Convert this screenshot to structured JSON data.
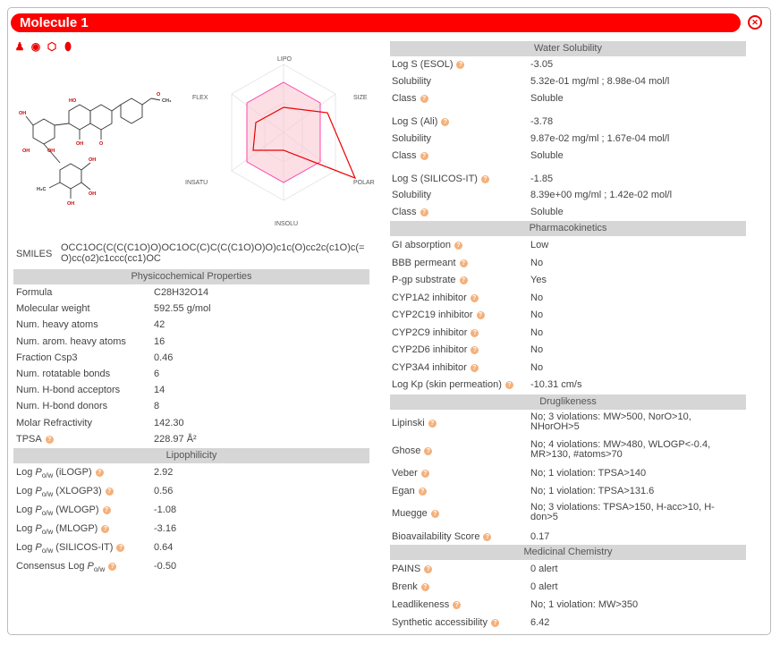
{
  "title": "Molecule 1",
  "close_icon": "close-circle-icon",
  "toolbar_icons": [
    "people-icon",
    "target-icon",
    "hexagon-icon",
    "pill-icon"
  ],
  "molecule_labels": {
    "methoxy": "O",
    "ch3": "CH₃",
    "oh": "OH",
    "h3c": "H₃C",
    "ho": "HO",
    "o": "O"
  },
  "radar": {
    "lipo": "LIPO",
    "size": "SIZE",
    "polar": "POLAR",
    "insolu": "INSOLU",
    "insatu": "INSATU",
    "flex": "FLEX"
  },
  "smiles": {
    "label": "SMILES",
    "value": "OCC1OC(C(C(C1O)O)OC1OC(C)C(C(C1O)O)O)c1c(O)cc2c(c1O)c(=O)cc(o2)c1ccc(cc1)OC"
  },
  "physchem": {
    "header": "Physicochemical Properties",
    "rows": [
      {
        "label": "Formula",
        "value": "C28H32O14"
      },
      {
        "label": "Molecular weight",
        "value": "592.55 g/mol"
      },
      {
        "label": "Num. heavy atoms",
        "value": "42"
      },
      {
        "label": "Num. arom. heavy atoms",
        "value": "16"
      },
      {
        "label": "Fraction Csp3",
        "value": "0.46"
      },
      {
        "label": "Num. rotatable bonds",
        "value": "6"
      },
      {
        "label": "Num. H-bond acceptors",
        "value": "14"
      },
      {
        "label": "Num. H-bond donors",
        "value": "8"
      },
      {
        "label": "Molar Refractivity",
        "value": "142.30"
      },
      {
        "label": "TPSA",
        "value": "228.97 Å²"
      }
    ]
  },
  "lipophilicity": {
    "header": "Lipophilicity",
    "rows": [
      {
        "prefix": "Log ",
        "p": "P",
        "sub": "o/w",
        "suffix": " (iLOGP)",
        "value": "2.92"
      },
      {
        "prefix": "Log ",
        "p": "P",
        "sub": "o/w",
        "suffix": " (XLOGP3)",
        "value": "0.56"
      },
      {
        "prefix": "Log ",
        "p": "P",
        "sub": "o/w",
        "suffix": " (WLOGP)",
        "value": "-1.08"
      },
      {
        "prefix": "Log ",
        "p": "P",
        "sub": "o/w",
        "suffix": " (MLOGP)",
        "value": "-3.16"
      },
      {
        "prefix": "Log ",
        "p": "P",
        "sub": "o/w",
        "suffix": " (SILICOS-IT)",
        "value": "0.64"
      },
      {
        "prefix": "Consensus Log ",
        "p": "P",
        "sub": "o/w",
        "suffix": "",
        "value": "-0.50"
      }
    ]
  },
  "solubility": {
    "header": "Water Solubility",
    "rows": [
      {
        "label": "Log S (ESOL)",
        "value": "-3.05"
      },
      {
        "label": "Solubility",
        "value": "5.32e-01 mg/ml ; 8.98e-04 mol/l"
      },
      {
        "label": "Class",
        "value": "Soluble"
      },
      {
        "label": "Log S (Ali)",
        "value": "-3.78"
      },
      {
        "label": "Solubility",
        "value": "9.87e-02 mg/ml ; 1.67e-04 mol/l"
      },
      {
        "label": "Class",
        "value": "Soluble"
      },
      {
        "label": "Log S (SILICOS-IT)",
        "value": "-1.85"
      },
      {
        "label": "Solubility",
        "value": "8.39e+00 mg/ml ; 1.42e-02 mol/l"
      },
      {
        "label": "Class",
        "value": "Soluble"
      }
    ]
  },
  "pharmacokinetics": {
    "header": "Pharmacokinetics",
    "rows": [
      {
        "label": "GI absorption",
        "value": "Low"
      },
      {
        "label": "BBB permeant",
        "value": "No"
      },
      {
        "label": "P-gp substrate",
        "value": "Yes"
      },
      {
        "label": "CYP1A2 inhibitor",
        "value": "No"
      },
      {
        "label": "CYP2C19 inhibitor",
        "value": "No"
      },
      {
        "label": "CYP2C9 inhibitor",
        "value": "No"
      },
      {
        "label": "CYP2D6 inhibitor",
        "value": "No"
      },
      {
        "label": "CYP3A4 inhibitor",
        "value": "No"
      },
      {
        "label": "Log Kp (skin permeation)",
        "value": "-10.31 cm/s"
      }
    ]
  },
  "druglikeness": {
    "header": "Druglikeness",
    "rows": [
      {
        "label": "Lipinski",
        "value": "No; 3 violations: MW>500, NorO>10, NHorOH>5"
      },
      {
        "label": "Ghose",
        "value": "No; 4 violations: MW>480, WLOGP<-0.4, MR>130, #atoms>70"
      },
      {
        "label": "Veber",
        "value": "No; 1 violation: TPSA>140"
      },
      {
        "label": "Egan",
        "value": "No; 1 violation: TPSA>131.6"
      },
      {
        "label": "Muegge",
        "value": "No; 3 violations: TPSA>150, H-acc>10, H-don>5"
      },
      {
        "label": "Bioavailability Score",
        "value": "0.17"
      }
    ]
  },
  "medchem": {
    "header": "Medicinal Chemistry",
    "rows": [
      {
        "label": "PAINS",
        "value": "0 alert"
      },
      {
        "label": "Brenk",
        "value": "0 alert"
      },
      {
        "label": "Leadlikeness",
        "value": "No; 1 violation: MW>350"
      },
      {
        "label": "Synthetic accessibility",
        "value": "6.42"
      }
    ]
  }
}
